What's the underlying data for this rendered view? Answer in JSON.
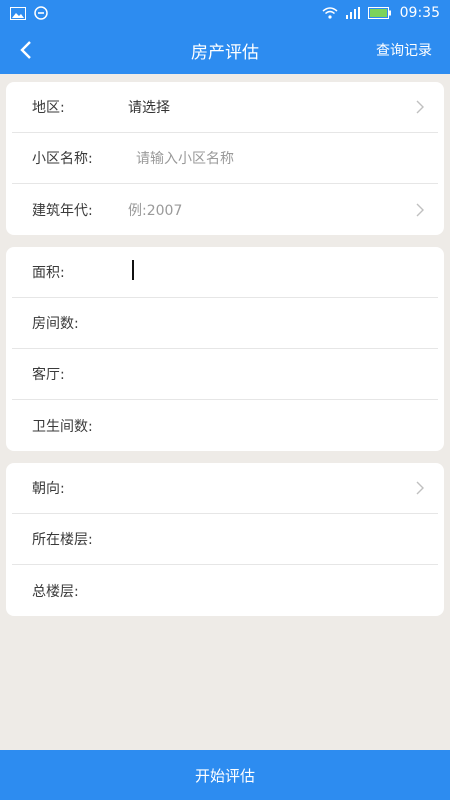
{
  "status_bar": {
    "time": "09:35"
  },
  "header": {
    "title": "房产评估",
    "history_label": "查询记录"
  },
  "section1": {
    "region": {
      "label": "地区:",
      "value": "请选择"
    },
    "community": {
      "label": "小区名称:",
      "placeholder": "请输入小区名称"
    },
    "build_year": {
      "label": "建筑年代:",
      "placeholder": "例:2007"
    }
  },
  "section2": {
    "area": {
      "label": "面积:"
    },
    "rooms": {
      "label": "房间数:"
    },
    "halls": {
      "label": "客厅:"
    },
    "bathrooms": {
      "label": "卫生间数:"
    }
  },
  "section3": {
    "orientation": {
      "label": "朝向:"
    },
    "floor": {
      "label": "所在楼层:"
    },
    "total_floors": {
      "label": "总楼层:"
    }
  },
  "footer": {
    "start_label": "开始评估"
  },
  "colors": {
    "primary": "#2d8cf0",
    "background": "#eeebe7"
  }
}
